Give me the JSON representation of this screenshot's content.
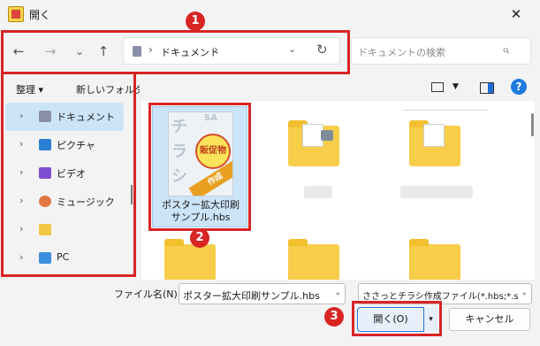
{
  "window": {
    "title": "開く",
    "close_glyph": "✕"
  },
  "nav": {
    "back_glyph": "←",
    "forward_glyph": "→",
    "recent_glyph": "⌄",
    "up_glyph": "↑",
    "address": {
      "sep": "›",
      "path": "ドキュメント",
      "drop_glyph": "⌄",
      "refresh_glyph": "↻"
    },
    "search": {
      "placeholder": "ドキュメントの検索",
      "icon_glyph": "⌕"
    }
  },
  "toolbar": {
    "organize": "整理 ▾",
    "new_folder": "新しいフォルダー",
    "view_arrow": "▼",
    "help": "?"
  },
  "sidebar": {
    "items": [
      {
        "label": "ドキュメント",
        "icon": "documents-icon",
        "selected": true
      },
      {
        "label": "ピクチャ",
        "icon": "pictures-icon"
      },
      {
        "label": "ビデオ",
        "icon": "videos-icon"
      },
      {
        "label": "ミュージック",
        "icon": "music-icon"
      },
      {
        "label": "",
        "icon": "folder-icon"
      },
      {
        "label": "PC",
        "icon": "pc-icon"
      }
    ],
    "chevron": "›"
  },
  "content": {
    "selected_file": {
      "name": "ポスター拡大印刷サンプル.hbs",
      "thumb_chars": [
        "チ",
        "ラ",
        "シ"
      ],
      "thumb_sa": "SA",
      "badge": "販促物",
      "ribbon": "作成"
    }
  },
  "bottom": {
    "filename_label": "ファイル名(N):",
    "filename_value": "ポスター拡大印刷サンプル.hbs",
    "filetype_value": "ささっとチラシ作成ファイル(*.hbs;*.s",
    "open_button": "開く(O)",
    "open_arrow": "▾",
    "cancel_button": "キャンセル",
    "dropdown_glyph": "⌄"
  },
  "annotations": [
    "1",
    "2",
    "3"
  ],
  "colors": {
    "annotation_red": "#d92424",
    "selection_blue": "#cce4f7",
    "accent": "#1d6fd6"
  }
}
